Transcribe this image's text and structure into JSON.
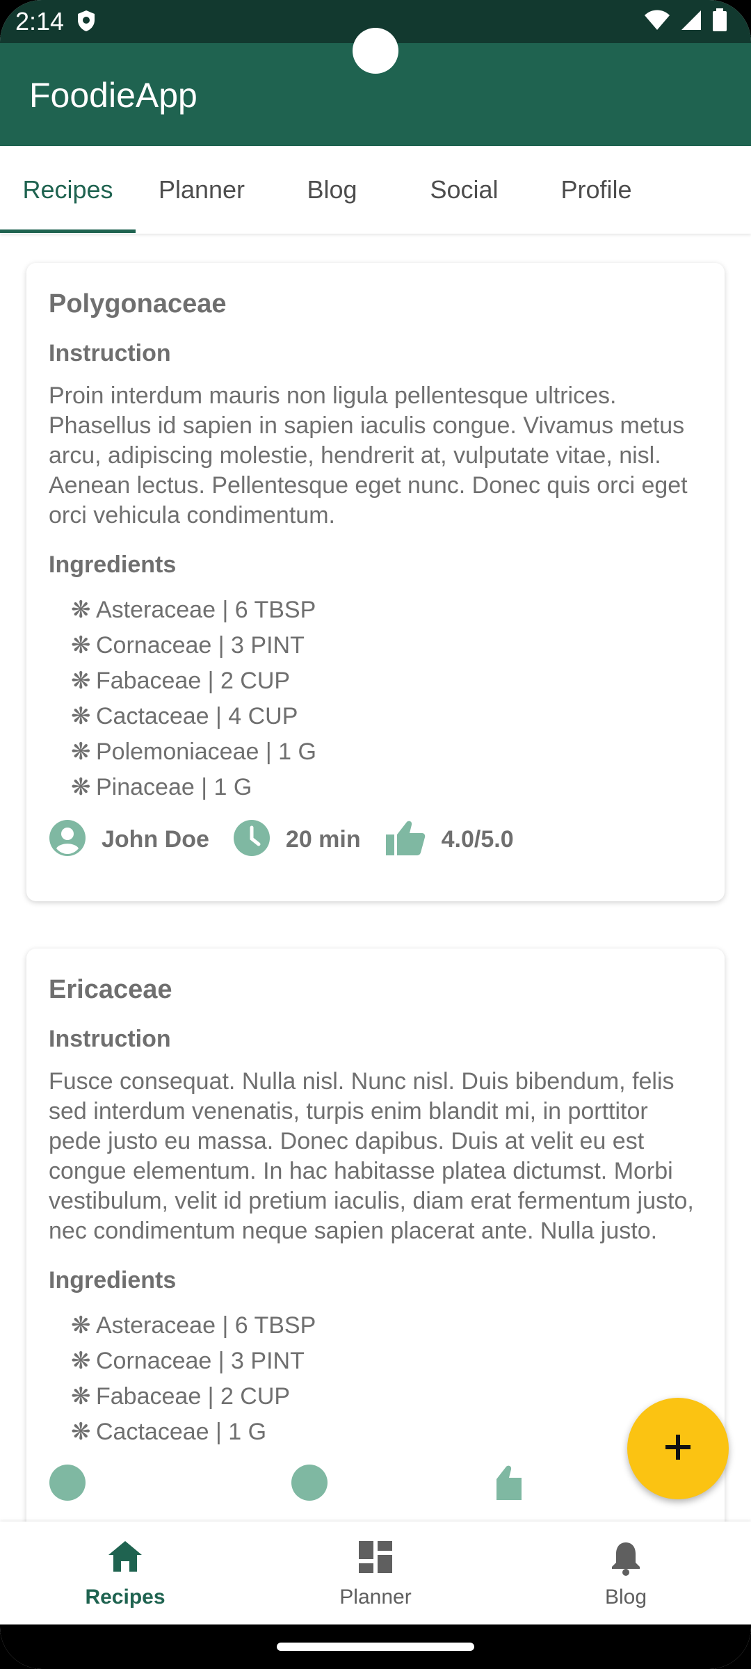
{
  "status_bar": {
    "time": "2:14"
  },
  "app_bar": {
    "title": "FoodieApp"
  },
  "tabs": [
    {
      "label": "Recipes",
      "active": true
    },
    {
      "label": "Planner",
      "active": false
    },
    {
      "label": "Blog",
      "active": false
    },
    {
      "label": "Social",
      "active": false
    },
    {
      "label": "Profile",
      "active": false
    }
  ],
  "recipes": [
    {
      "title": "Polygonaceae",
      "instruction_label": "Instruction",
      "instruction": "Proin interdum mauris non ligula pellentesque ultrices. Phasellus id sapien in sapien iaculis congue. Vivamus metus arcu, adipiscing molestie, hendrerit at, vulputate vitae, nisl. Aenean lectus. Pellentesque eget nunc. Donec quis orci eget orci vehicula condimentum.",
      "ingredients_label": "Ingredients",
      "ingredients": [
        "Asteraceae | 6 TBSP",
        "Cornaceae | 3 PINT",
        "Fabaceae | 2 CUP",
        "Cactaceae | 4 CUP",
        "Polemoniaceae | 1 G",
        "Pinaceae | 1 G"
      ],
      "author": "John Doe",
      "time": "20 min",
      "rating": "4.0/5.0"
    },
    {
      "title": "Ericaceae",
      "instruction_label": "Instruction",
      "instruction": "Fusce consequat. Nulla nisl. Nunc nisl. Duis bibendum, felis sed interdum venenatis, turpis enim blandit mi, in porttitor pede justo eu massa. Donec dapibus. Duis at velit eu est congue elementum. In hac habitasse platea dictumst. Morbi vestibulum, velit id pretium iaculis, diam erat fermentum justo, nec condimentum neque sapien placerat ante. Nulla justo.",
      "ingredients_label": "Ingredients",
      "ingredients": [
        "Asteraceae | 6 TBSP",
        "Cornaceae | 3 PINT",
        "Fabaceae | 2 CUP",
        "Cactaceae | 1 G"
      ]
    }
  ],
  "bottom_nav": [
    {
      "label": "Recipes",
      "icon": "home-icon",
      "active": true
    },
    {
      "label": "Planner",
      "icon": "dashboard-icon",
      "active": false
    },
    {
      "label": "Blog",
      "icon": "bell-icon",
      "active": false
    }
  ],
  "ingredient_bullet": "❋",
  "colors": {
    "primary": "#1f6350",
    "status_bar": "#12392f",
    "accent": "#fbc312",
    "icon_green": "#7fb8a2",
    "text_gray": "#6f6f6f"
  }
}
